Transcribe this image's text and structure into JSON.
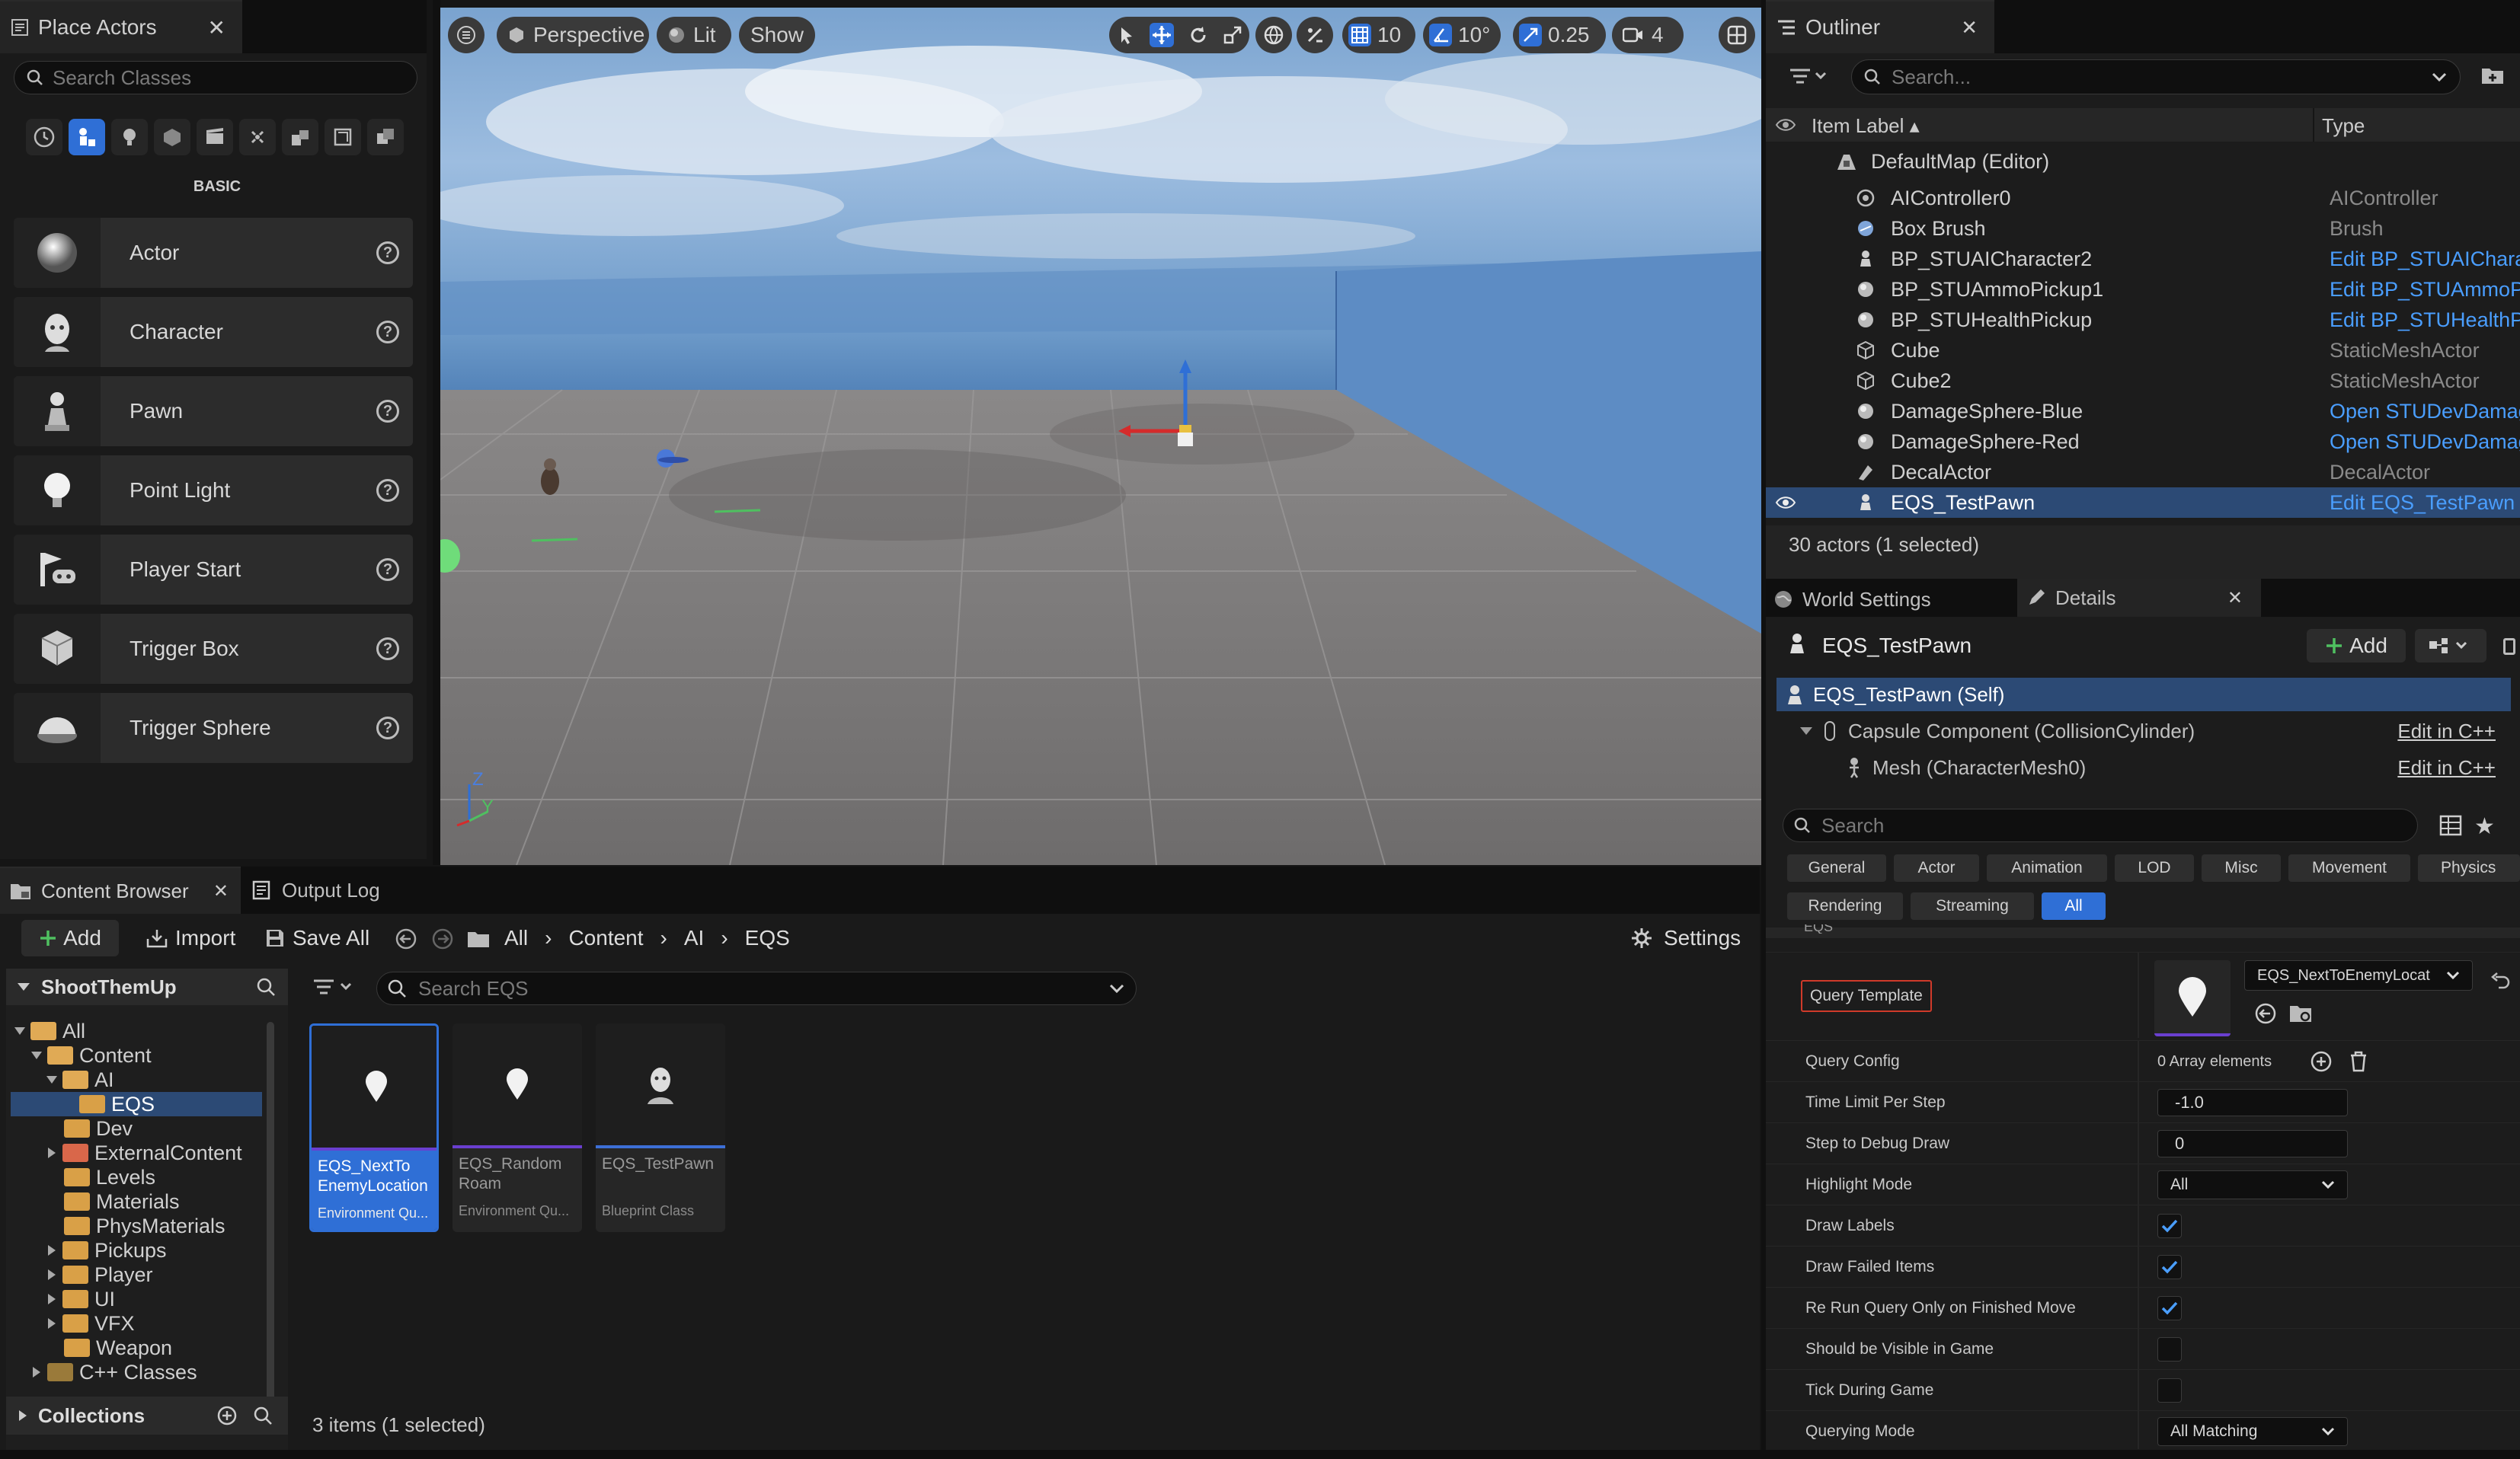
{
  "place_actors": {
    "tab_title": "Place Actors",
    "search_placeholder": "Search Classes",
    "section_label": "BASIC",
    "items": [
      {
        "label": "Actor",
        "icon": "sphere-icon"
      },
      {
        "label": "Character",
        "icon": "character-icon"
      },
      {
        "label": "Pawn",
        "icon": "pawn-icon"
      },
      {
        "label": "Point Light",
        "icon": "bulb-icon"
      },
      {
        "label": "Player Start",
        "icon": "player-start-icon"
      },
      {
        "label": "Trigger Box",
        "icon": "trigger-box-icon"
      },
      {
        "label": "Trigger Sphere",
        "icon": "trigger-sphere-icon"
      }
    ]
  },
  "viewport": {
    "perspective_label": "Perspective",
    "lit_label": "Lit",
    "show_label": "Show",
    "grid_snap": "10",
    "rotation_snap": "10°",
    "scale_snap": "0.25",
    "camera_speed": "4",
    "axis_z": "Z",
    "axis_y": "Y",
    "axis_x": "X"
  },
  "outliner": {
    "tab_title": "Outliner",
    "search_placeholder": "Search...",
    "col_label": "Item Label ▴",
    "col_type": "Type",
    "map_label": "DefaultMap (Editor)",
    "rows": [
      {
        "label": "AIController0",
        "type": "AIController",
        "link": false
      },
      {
        "label": "Box Brush",
        "type": "Brush",
        "link": false
      },
      {
        "label": "BP_STUAICharacter2",
        "type": "Edit BP_STUAIChara",
        "link": true
      },
      {
        "label": "BP_STUAmmoPickup1",
        "type": "Edit BP_STUAmmoP",
        "link": true
      },
      {
        "label": "BP_STUHealthPickup",
        "type": "Edit BP_STUHealthP",
        "link": true
      },
      {
        "label": "Cube",
        "type": "StaticMeshActor",
        "link": false
      },
      {
        "label": "Cube2",
        "type": "StaticMeshActor",
        "link": false
      },
      {
        "label": "DamageSphere-Blue",
        "type": "Open STUDevDamag",
        "link": true
      },
      {
        "label": "DamageSphere-Red",
        "type": "Open STUDevDamag",
        "link": true
      },
      {
        "label": "DecalActor",
        "type": "DecalActor",
        "link": false
      },
      {
        "label": "EQS_TestPawn",
        "type": "Edit EQS_TestPawn",
        "link": true
      }
    ],
    "status": "30 actors (1 selected)"
  },
  "details": {
    "world_settings_tab": "World Settings",
    "details_tab": "Details",
    "actor_name": "EQS_TestPawn",
    "add_label": "Add",
    "components": [
      {
        "label": "EQS_TestPawn (Self)",
        "action": ""
      },
      {
        "label": "Capsule Component (CollisionCylinder)",
        "action": "Edit in C++"
      },
      {
        "label": "Mesh (CharacterMesh0)",
        "action": "Edit in C++"
      }
    ],
    "search_placeholder": "Search",
    "filters_row1": [
      "General",
      "Actor",
      "Animation",
      "LOD",
      "Misc",
      "Movement",
      "Physics"
    ],
    "filters_row2": [
      "Rendering",
      "Streaming",
      "All"
    ],
    "section_label": "EQS",
    "query_template_label": "Query Template",
    "query_template_value": "EQS_NextToEnemyLocat",
    "properties": [
      {
        "label": "Query Config",
        "kind": "array",
        "value": "0 Array elements"
      },
      {
        "label": "Time Limit Per Step",
        "kind": "number",
        "value": "-1.0"
      },
      {
        "label": "Step to Debug Draw",
        "kind": "number",
        "value": "0"
      },
      {
        "label": "Highlight Mode",
        "kind": "combo",
        "value": "All"
      },
      {
        "label": "Draw Labels",
        "kind": "check",
        "value": "true"
      },
      {
        "label": "Draw Failed Items",
        "kind": "check",
        "value": "true"
      },
      {
        "label": "Re Run Query Only on Finished Move",
        "kind": "check",
        "value": "true"
      },
      {
        "label": "Should be Visible in Game",
        "kind": "check",
        "value": "false"
      },
      {
        "label": "Tick During Game",
        "kind": "check",
        "value": "false"
      },
      {
        "label": "Querying Mode",
        "kind": "combo",
        "value": "All Matching"
      }
    ]
  },
  "content_browser": {
    "tab_title": "Content Browser",
    "output_log_tab": "Output Log",
    "add_label": "Add",
    "import_label": "Import",
    "save_all_label": "Save All",
    "breadcrumb": [
      "All",
      "Content",
      "AI",
      "EQS"
    ],
    "settings_label": "Settings",
    "project_name": "ShootThemUp",
    "search_placeholder": "Search EQS",
    "tree": [
      {
        "label": "All"
      },
      {
        "label": "Content"
      },
      {
        "label": "AI"
      },
      {
        "label": "EQS"
      },
      {
        "label": "Dev"
      },
      {
        "label": "ExternalContent"
      },
      {
        "label": "Levels"
      },
      {
        "label": "Materials"
      },
      {
        "label": "PhysMaterials"
      },
      {
        "label": "Pickups"
      },
      {
        "label": "Player"
      },
      {
        "label": "UI"
      },
      {
        "label": "VFX"
      },
      {
        "label": "Weapon"
      },
      {
        "label": "C++ Classes"
      }
    ],
    "collections_label": "Collections",
    "assets": [
      {
        "name": "EQS_NextTo EnemyLocation",
        "type": "Environment Qu...",
        "color": "#6a3fd0"
      },
      {
        "name": "EQS_Random Roam",
        "type": "Environment Qu...",
        "color": "#6a3fd0"
      },
      {
        "name": "EQS_TestPawn",
        "type": "Blueprint Class",
        "color": "#3d6fd6"
      }
    ],
    "status": "3 items (1 selected)"
  },
  "colors": {
    "accent": "#2f6fd6",
    "selected_row": "#2c4a75",
    "link": "#4a9eff",
    "highlight_border": "#d03a2a"
  }
}
